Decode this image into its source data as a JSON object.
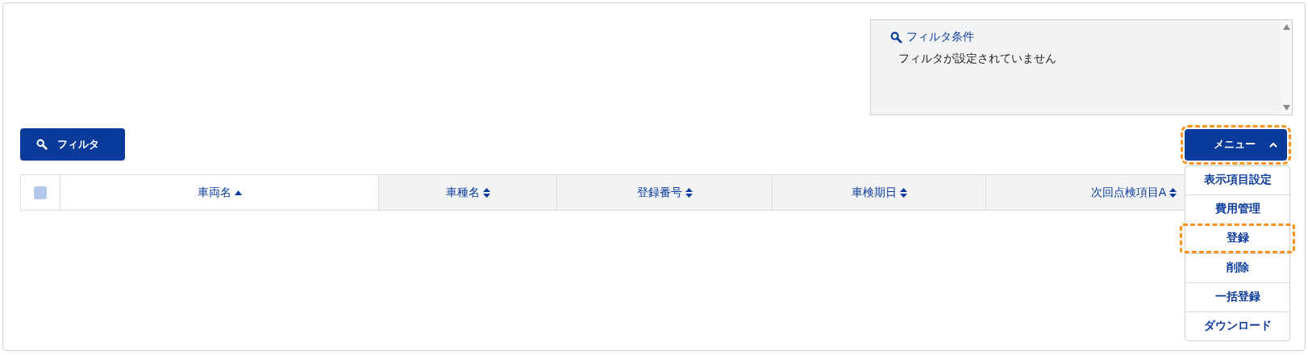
{
  "filter_panel": {
    "title": "フィルタ条件",
    "message": "フィルタが設定されていません"
  },
  "filter_button": {
    "label": "フィルタ"
  },
  "menu_button": {
    "label": "メニュー",
    "expanded": true,
    "highlighted": true
  },
  "menu_items": [
    {
      "label": "表示項目設定",
      "highlighted": false
    },
    {
      "label": "費用管理",
      "highlighted": false
    },
    {
      "label": "登録",
      "highlighted": true
    },
    {
      "label": "削除",
      "highlighted": false
    },
    {
      "label": "一括登録",
      "highlighted": false
    },
    {
      "label": "ダウンロード",
      "highlighted": false
    }
  ],
  "table": {
    "select_all": {
      "checked": false
    },
    "columns": [
      {
        "label": "車両名",
        "sorted": true
      },
      {
        "label": "車種名",
        "sorted": false
      },
      {
        "label": "登録番号",
        "sorted": false
      },
      {
        "label": "車検期日",
        "sorted": false
      },
      {
        "label": "次回点検項目A",
        "sorted": false
      }
    ]
  }
}
